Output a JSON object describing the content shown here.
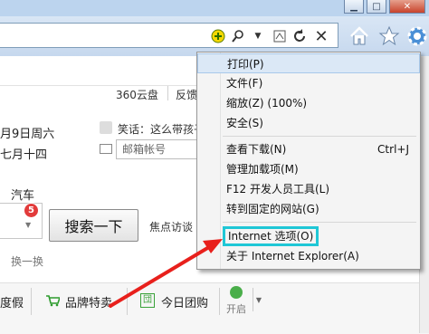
{
  "menu": {
    "items": [
      {
        "label": "打印(P)",
        "accel": ""
      },
      {
        "label": "文件(F)",
        "accel": ""
      },
      {
        "label": "缩放(Z) (100%)",
        "accel": ""
      },
      {
        "label": "安全(S)",
        "accel": ""
      },
      {
        "label": "查看下载(N)",
        "accel": "Ctrl+J"
      },
      {
        "label": "管理加载项(M)",
        "accel": ""
      },
      {
        "label": "F12 开发人员工具(L)",
        "accel": ""
      },
      {
        "label": "转到固定的网站(G)",
        "accel": ""
      },
      {
        "label": "Internet 选项(O)",
        "accel": ""
      },
      {
        "label": "关于 Internet Explorer(A)",
        "accel": ""
      }
    ],
    "highlight_color": "#1fc7d6",
    "arrow_color": "#e8201c"
  },
  "page": {
    "top_links": [
      "360云盘",
      "反馈"
    ],
    "date_line1": "月9日周六",
    "date_line2": "七月十四",
    "joke_text": "笑话：这么带孩子",
    "mail_placeholder": "邮箱帐号",
    "category": "汽车",
    "badge_count": "5",
    "search_button": "搜索一下",
    "focus_label": "焦点访谈",
    "refresh_label": "换一换",
    "bottom_items": [
      "度假",
      "品牌特卖",
      "今日团购"
    ],
    "open_label": "开启"
  },
  "icons": [
    "add-icon",
    "search-icon",
    "dropdown-icon",
    "compat-icon",
    "refresh-icon",
    "close-icon",
    "home-icon",
    "star-icon",
    "gear-icon"
  ]
}
